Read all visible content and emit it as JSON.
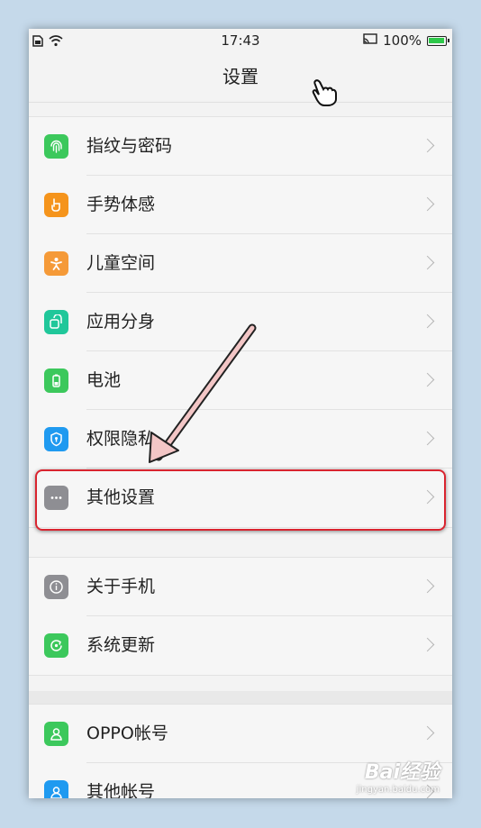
{
  "status_bar": {
    "time": "17:43",
    "battery": "100%",
    "battery_level": 1.0
  },
  "header": {
    "title": "设置"
  },
  "groups": [
    {
      "items": [
        {
          "label": "指纹与密码",
          "icon": "fingerprint-icon",
          "color": "#3cc85c"
        },
        {
          "label": "手势体感",
          "icon": "hand-gesture-icon",
          "color": "#f5941c"
        },
        {
          "label": "儿童空间",
          "icon": "child-icon",
          "color": "#f59a38"
        },
        {
          "label": "应用分身",
          "icon": "app-clone-icon",
          "color": "#20c79a"
        },
        {
          "label": "电池",
          "icon": "battery-icon",
          "color": "#3cc85c"
        },
        {
          "label": "权限隐私",
          "icon": "privacy-shield-icon",
          "color": "#1f9af0"
        },
        {
          "label": "其他设置",
          "icon": "more-dots-icon",
          "color": "#8e8e93"
        }
      ]
    },
    {
      "items": [
        {
          "label": "关于手机",
          "icon": "info-icon",
          "color": "#8e8e93"
        },
        {
          "label": "系统更新",
          "icon": "system-update-icon",
          "color": "#3cc85c"
        }
      ]
    },
    {
      "items": [
        {
          "label": "OPPO帐号",
          "icon": "user-icon",
          "color": "#3cc85c"
        },
        {
          "label": "其他帐号",
          "icon": "user-icon",
          "color": "#1f9af0"
        }
      ]
    }
  ],
  "annotation": {
    "highlight_color": "#d9242f",
    "arrow_color": "#f3c6c6"
  },
  "watermark": {
    "brand": "Bai经验",
    "url": "jingyan.baidu.com"
  }
}
